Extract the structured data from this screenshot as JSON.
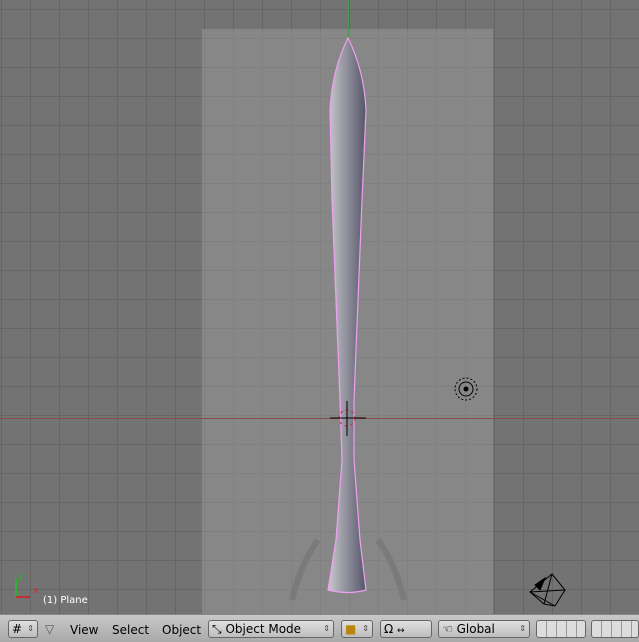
{
  "viewport": {
    "object_info": "(1) Plane",
    "axis_x": "x",
    "axis_y": "y"
  },
  "header": {
    "menus": [
      "View",
      "Select",
      "Object"
    ],
    "mode": "Object Mode",
    "orientation": "Global"
  },
  "colors": {
    "viewport_bg": "#737373",
    "selection_outline": "#f0a0f0",
    "x_axis": "#c03030",
    "y_axis": "#30b030"
  }
}
